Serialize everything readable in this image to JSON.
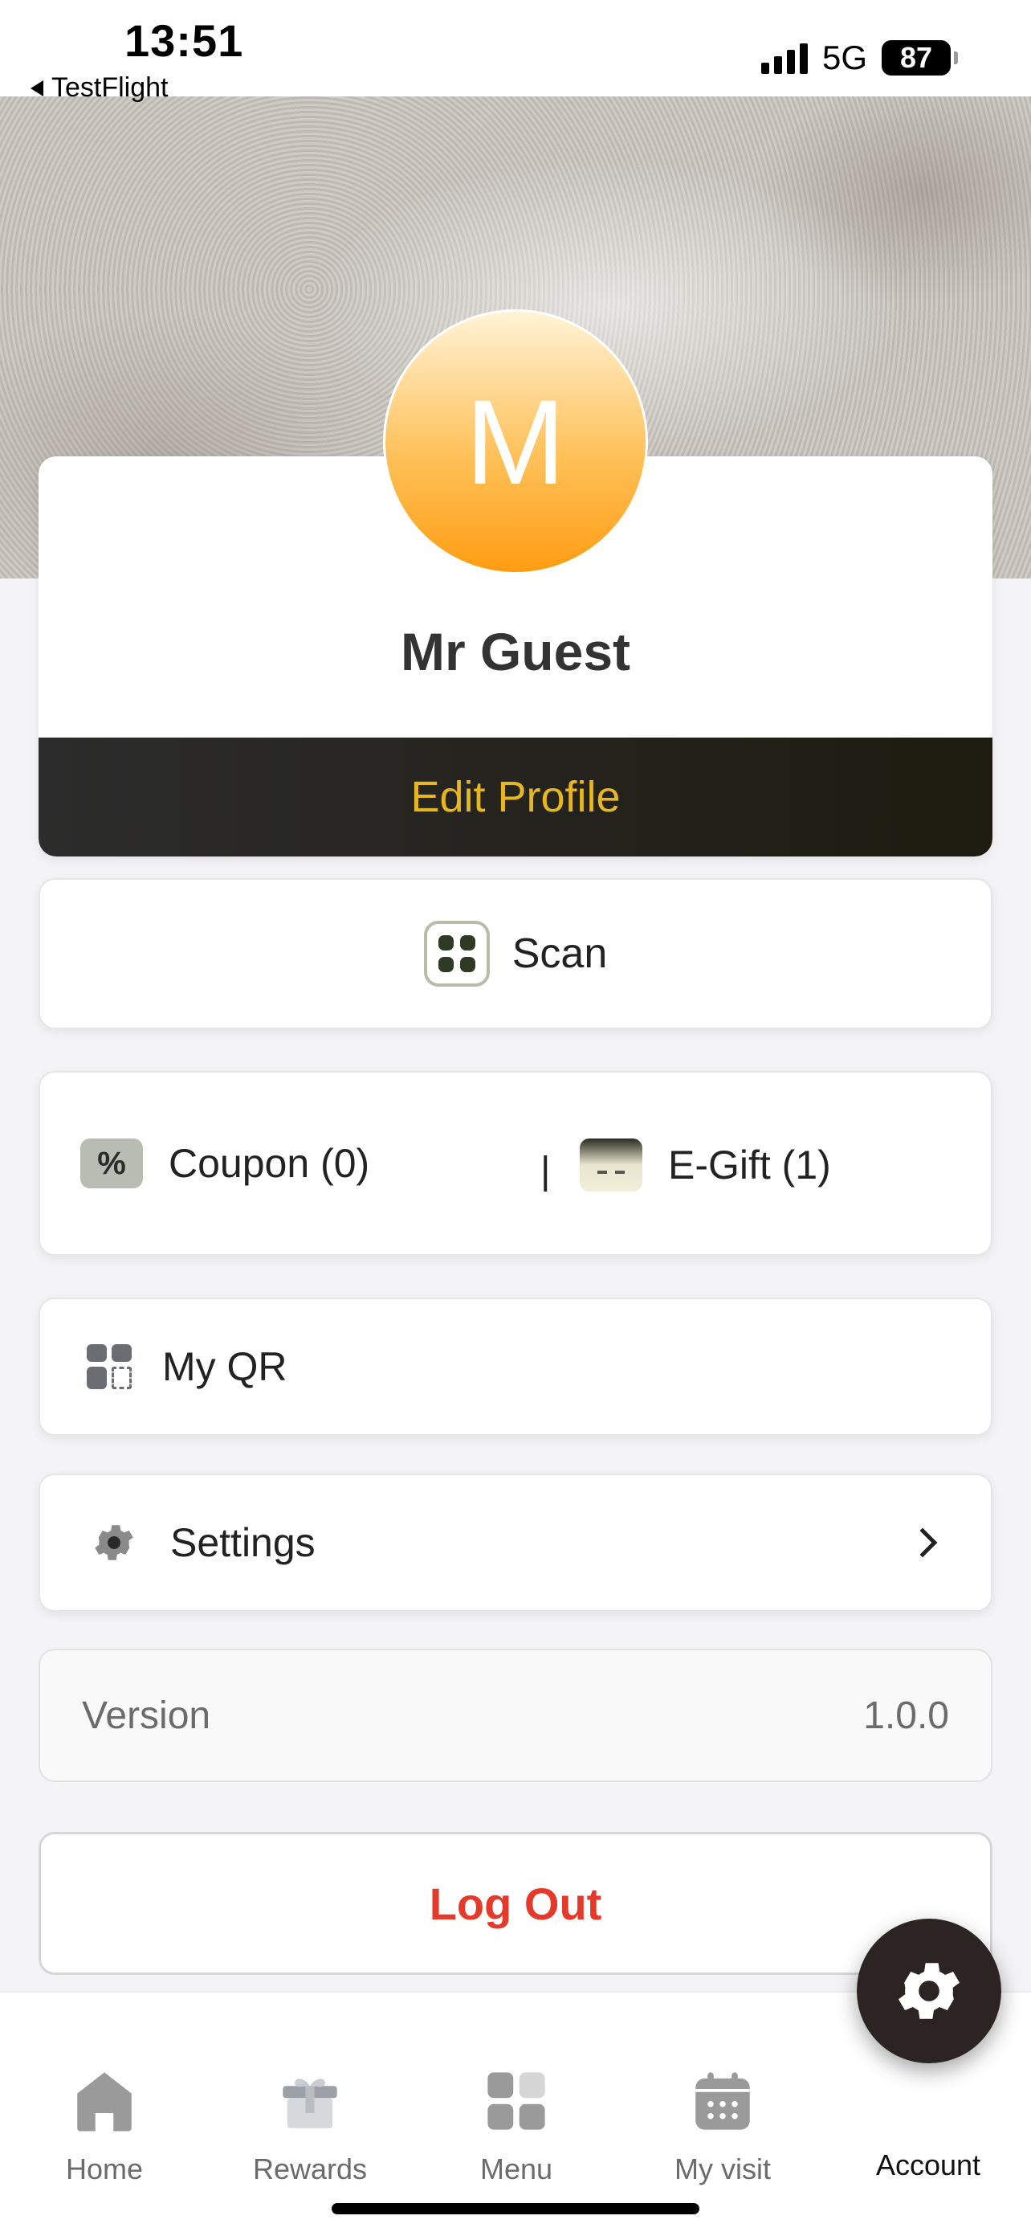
{
  "status_bar": {
    "time": "13:51",
    "back_app": "TestFlight",
    "network": "5G",
    "battery": "87"
  },
  "profile": {
    "avatar_initial": "M",
    "name": "Mr Guest",
    "edit_label": "Edit Profile"
  },
  "scan": {
    "label": "Scan",
    "icon": "scan-icon"
  },
  "wallet": {
    "coupon_label": "Coupon (0)",
    "divider": "|",
    "egift_label": "E-Gift (1)"
  },
  "qr": {
    "label": "My QR",
    "icon": "qr-code-icon"
  },
  "settings": {
    "label": "Settings",
    "icon": "gear-icon"
  },
  "version": {
    "label": "Version",
    "value": "1.0.0"
  },
  "logout": {
    "label": "Log Out"
  },
  "tabbar": {
    "items": [
      {
        "label": "Home",
        "icon": "home-icon"
      },
      {
        "label": "Rewards",
        "icon": "gift-icon"
      },
      {
        "label": "Menu",
        "icon": "grid-icon"
      },
      {
        "label": "My visit",
        "icon": "calendar-icon"
      },
      {
        "label": "Account",
        "icon": "gear-icon",
        "active": true
      }
    ]
  },
  "colors": {
    "accent_gold": "#e6b71e",
    "logout_red": "#e53a2a",
    "avatar_orange": "#ff9d12",
    "dark_band": "#2c2c2c"
  }
}
